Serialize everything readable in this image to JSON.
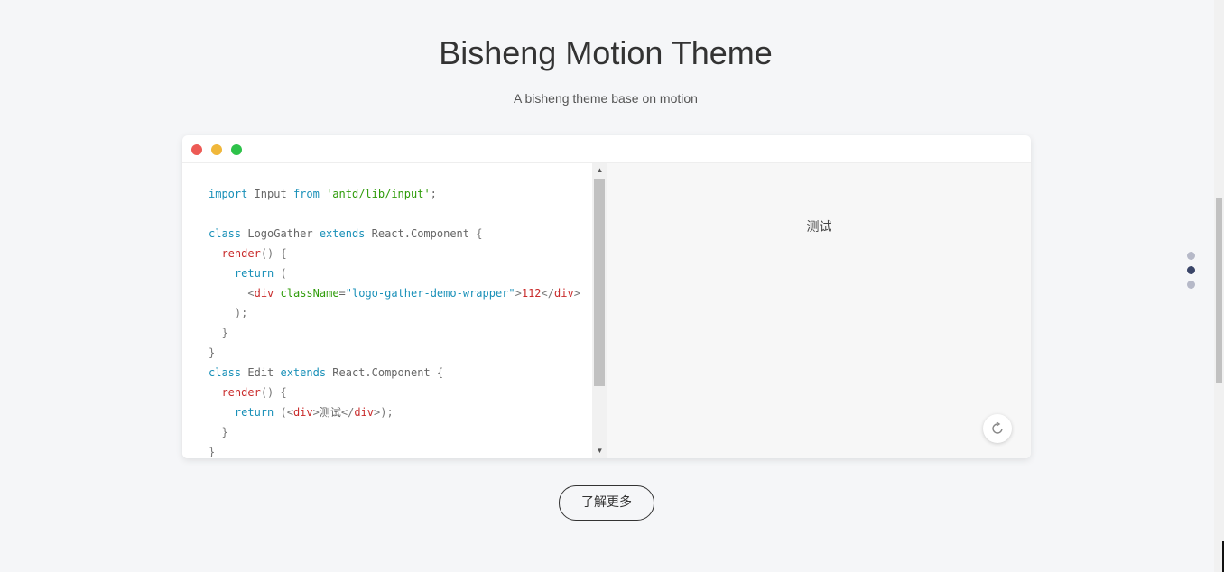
{
  "header": {
    "title": "Bisheng Motion Theme",
    "subtitle": "A bisheng theme base on motion"
  },
  "demo": {
    "window_controls": [
      "close-icon",
      "minimize-icon",
      "maximize-icon"
    ],
    "code_lines": [
      "import Input from 'antd/lib/input';",
      "",
      "class LogoGather extends React.Component {",
      "  render() {",
      "    return (",
      "      <div className=\"logo-gather-demo-wrapper\">112</div>",
      "    );",
      "  }",
      "}",
      "class Edit extends React.Component {",
      "  render() {",
      "    return (<div>测试</div>);",
      "  }",
      "}"
    ],
    "preview_text": "测试",
    "replay_icon": "refresh-icon"
  },
  "learn_more_label": "了解更多",
  "page_nav": {
    "dots": 3,
    "active_index": 1
  },
  "colors": {
    "background": "#f5f6f8",
    "close": "#ed5a55",
    "minimize": "#f0b73a",
    "maximize": "#2ec24a",
    "active_dot": "#3a4568",
    "inactive_dot": "#b6b9c8"
  }
}
